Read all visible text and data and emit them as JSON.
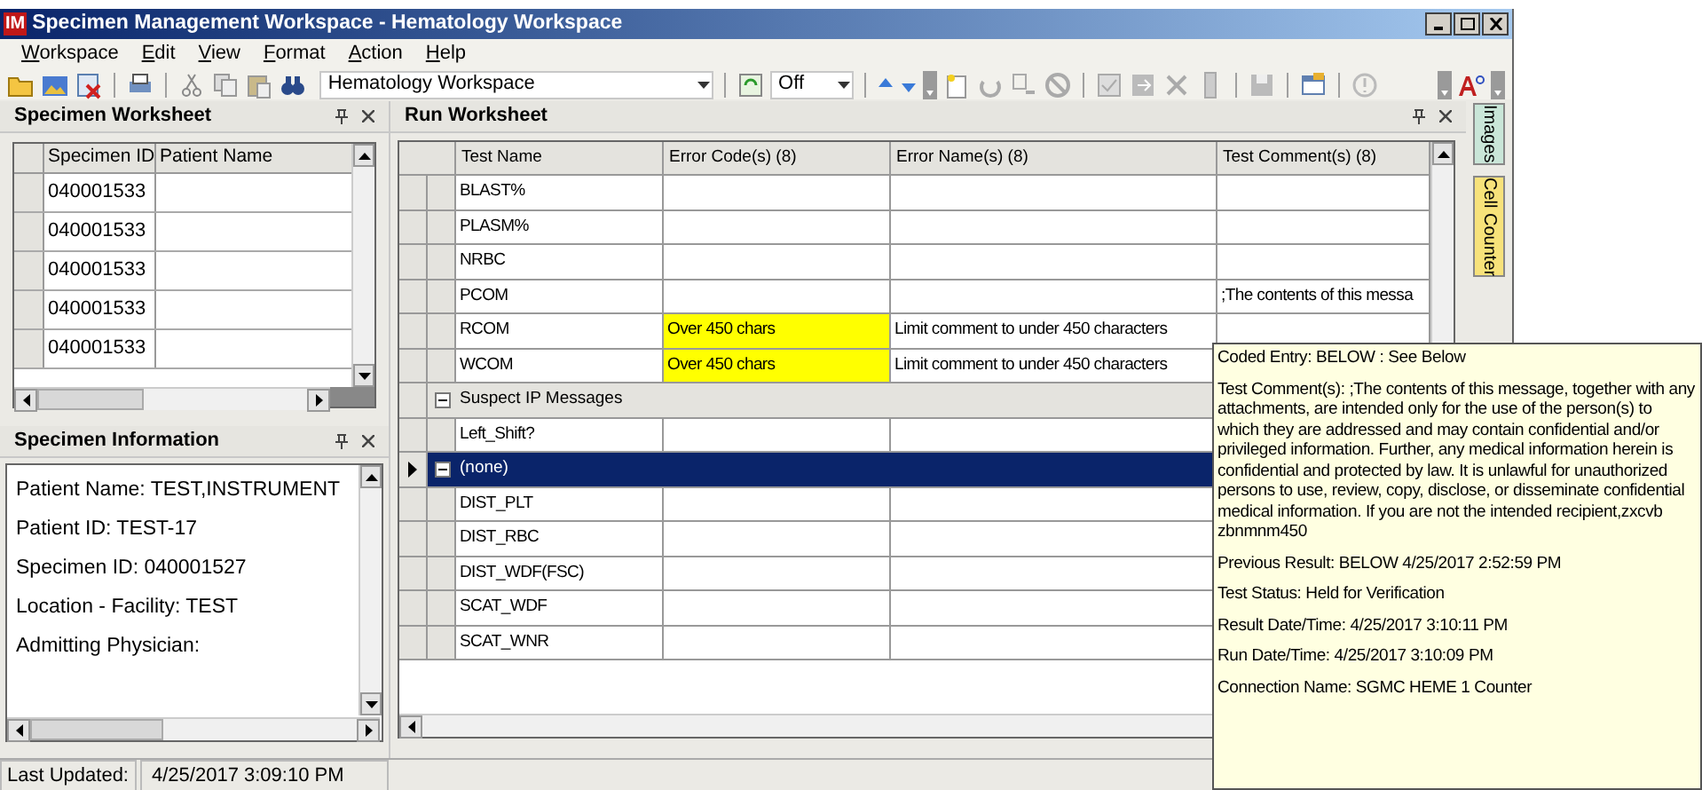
{
  "window": {
    "title": "Specimen Management Workspace - Hematology Workspace",
    "logo": "IM"
  },
  "menu": [
    {
      "label": "Workspace"
    },
    {
      "label": "Edit"
    },
    {
      "label": "View"
    },
    {
      "label": "Format"
    },
    {
      "label": "Action"
    },
    {
      "label": "Help"
    }
  ],
  "toolbar": {
    "workspace": "Hematology Workspace",
    "mode": "Off"
  },
  "specimen_worksheet": {
    "title": "Specimen Worksheet",
    "columns": [
      "Specimen ID",
      "Patient Name"
    ],
    "rows": [
      {
        "specimen_id": "040001533"
      },
      {
        "specimen_id": "040001533"
      },
      {
        "specimen_id": "040001533"
      },
      {
        "specimen_id": "040001533"
      },
      {
        "specimen_id": "040001533"
      }
    ]
  },
  "specimen_information": {
    "title": "Specimen Information",
    "lines": [
      "Patient Name:  TEST,INSTRUMENT",
      "Patient ID:  TEST-17",
      "Specimen ID:  040001527",
      "Location - Facility:  TEST",
      "Admitting Physician:"
    ]
  },
  "status_bar": {
    "label": "Last Updated:",
    "value": "4/25/2017  3:09:10 PM"
  },
  "run_worksheet": {
    "title": "Run Worksheet",
    "columns": [
      "Test Name",
      "Error Code(s) (8)",
      "Error Name(s) (8)",
      "Test Comment(s) (8)"
    ],
    "rows": [
      {
        "kind": "test",
        "test_name": "BLAST%",
        "flagged": false,
        "selected": false
      },
      {
        "kind": "test",
        "test_name": "PLASM%",
        "flagged": false,
        "selected": false
      },
      {
        "kind": "test",
        "test_name": "NRBC",
        "flagged": false,
        "selected": false
      },
      {
        "kind": "test",
        "test_name": "PCOM",
        "test_comment": ";The contents of this messa",
        "flagged": false,
        "selected": false
      },
      {
        "kind": "test",
        "test_name": "RCOM",
        "error_code": "Over 450 chars",
        "error_name": "Limit comment to under 450 characters",
        "flagged": true,
        "selected": false
      },
      {
        "kind": "test",
        "test_name": "WCOM",
        "error_code": "Over 450 chars",
        "error_name": "Limit comment to under 450 characters",
        "flagged": true,
        "selected": false
      },
      {
        "kind": "group",
        "label": "Suspect IP Messages",
        "expanded": true,
        "selected": false
      },
      {
        "kind": "test",
        "test_name": "Left_Shift?",
        "flagged": false,
        "selected": false
      },
      {
        "kind": "group",
        "label": "(none)",
        "expanded": true,
        "selected": true
      },
      {
        "kind": "test",
        "test_name": "DIST_PLT",
        "flagged": false,
        "selected": false
      },
      {
        "kind": "test",
        "test_name": "DIST_RBC",
        "flagged": false,
        "selected": false
      },
      {
        "kind": "test",
        "test_name": "DIST_WDF(FSC)",
        "flagged": false,
        "selected": false
      },
      {
        "kind": "test",
        "test_name": "SCAT_WDF",
        "flagged": false,
        "selected": false
      },
      {
        "kind": "test",
        "test_name": "SCAT_WNR",
        "flagged": false,
        "selected": false
      }
    ]
  },
  "side_tabs": [
    {
      "label": "Images",
      "color": "#c9e6d8"
    },
    {
      "label": "Cell Counter",
      "color": "#f7e27a"
    }
  ],
  "tooltip": {
    "lines": [
      "Coded Entry: BELOW  :  See Below",
      "Test Comment(s): ;The contents of this message, together with any attachments, are intended only for the use of the person(s) to which they are addressed and may contain confidential and/or privileged information. Further, any medical information herein is confidential and protected by law. It is unlawful for unauthorized persons to use, review, copy, disclose, or disseminate confidential medical information. If you are not the intended recipient,zxcvb zbnmnm450",
      "Previous Result: BELOW 4/25/2017 2:52:59 PM",
      "Test Status: Held for Verification",
      "Result Date/Time: 4/25/2017 3:10:11 PM",
      "Run Date/Time: 4/25/2017 3:10:09 PM",
      "Connection Name: SGMC HEME 1 Counter"
    ]
  }
}
